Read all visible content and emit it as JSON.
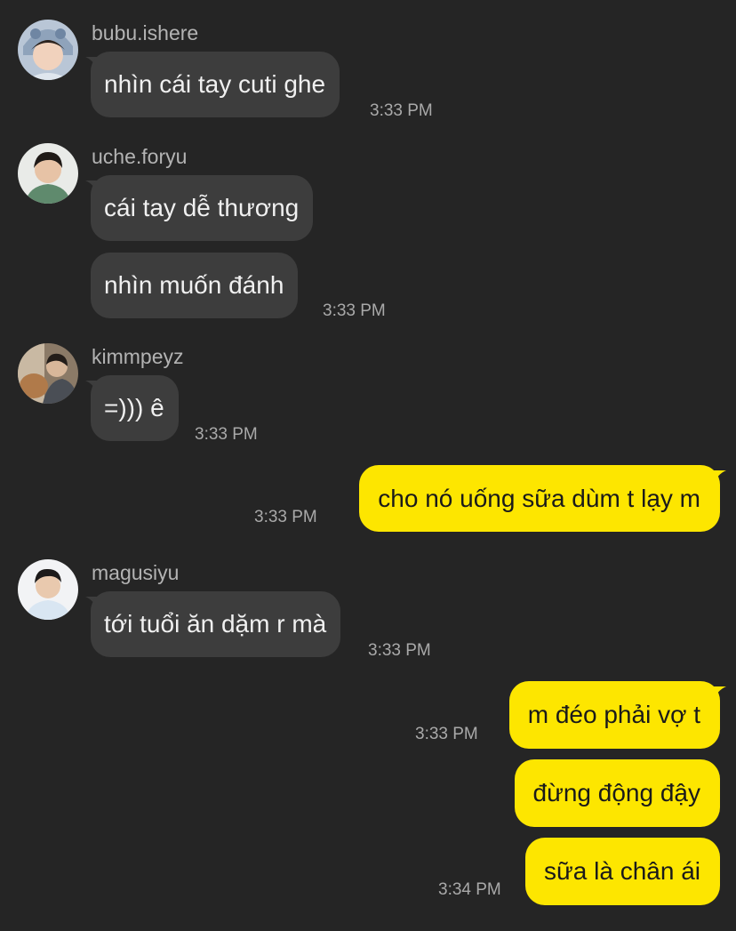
{
  "messages": {
    "m1": {
      "sender": "bubu.ishere",
      "text": "nhìn cái tay cuti ghe",
      "time": "3:33 PM"
    },
    "m2": {
      "sender": "uche.foryu",
      "text1": "cái tay dễ thương",
      "text2": "nhìn muốn đánh",
      "time": "3:33 PM"
    },
    "m3": {
      "sender": "kimmpeyz",
      "text": "=))) ê",
      "time": "3:33 PM"
    },
    "m4": {
      "text": "cho nó uống sữa dùm t lạy m",
      "time": "3:33 PM"
    },
    "m5": {
      "sender": "magusiyu",
      "text": "tới tuổi ăn dặm r mà",
      "time": "3:33 PM"
    },
    "m6": {
      "text1": "m đéo phải vợ t",
      "text2": "đừng động đậy",
      "time1": "3:33 PM",
      "text3": "sữa là chân ái",
      "time2": "3:34 PM"
    }
  },
  "avatars": [
    "user-avatar-bubu",
    "user-avatar-uche",
    "user-avatar-kimmpeyz",
    "user-avatar-magusiyu"
  ],
  "colors": {
    "background": "#252525",
    "incoming_bubble": "#3d3d3d",
    "outgoing_bubble": "#fde600"
  }
}
